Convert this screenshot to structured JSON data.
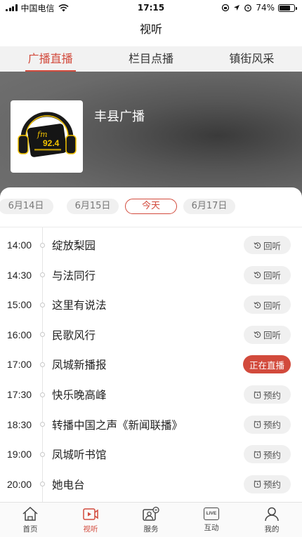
{
  "status_bar": {
    "carrier": "中国电信",
    "time": "17:15",
    "battery": "74%",
    "battery_level": 0.74
  },
  "header": {
    "title": "视听"
  },
  "tabs": [
    {
      "label": "广播直播",
      "active": true
    },
    {
      "label": "栏目点播",
      "active": false
    },
    {
      "label": "镇街风采",
      "active": false
    }
  ],
  "station": {
    "name": "丰县广播",
    "logo_text": {
      "fm": "fm",
      "freq": "92.4"
    }
  },
  "dates": [
    {
      "label": "6月14日",
      "selected": false
    },
    {
      "label": "6月15日",
      "selected": false
    },
    {
      "label": "今天",
      "selected": true
    },
    {
      "label": "6月17日",
      "selected": false
    }
  ],
  "programs": [
    {
      "time": "14:00",
      "title": "绽放梨园",
      "action": "回听",
      "icon": "replay-icon",
      "state": "replay"
    },
    {
      "time": "14:30",
      "title": "与法同行",
      "action": "回听",
      "icon": "replay-icon",
      "state": "replay"
    },
    {
      "time": "15:00",
      "title": "这里有说法",
      "action": "回听",
      "icon": "replay-icon",
      "state": "replay"
    },
    {
      "time": "16:00",
      "title": "民歌风行",
      "action": "回听",
      "icon": "replay-icon",
      "state": "replay"
    },
    {
      "time": "17:00",
      "title": "凤城新播报",
      "action": "正在直播",
      "icon": "",
      "state": "live"
    },
    {
      "time": "17:30",
      "title": "快乐晚高峰",
      "action": "预约",
      "icon": "alarm-clock-icon",
      "state": "reserve"
    },
    {
      "time": "18:30",
      "title": "转播中国之声《新闻联播》",
      "action": "预约",
      "icon": "alarm-clock-icon",
      "state": "reserve"
    },
    {
      "time": "19:00",
      "title": "凤城听书馆",
      "action": "预约",
      "icon": "alarm-clock-icon",
      "state": "reserve"
    },
    {
      "time": "20:00",
      "title": "她电台",
      "action": "预约",
      "icon": "alarm-clock-icon",
      "state": "reserve"
    }
  ],
  "bottom_nav": [
    {
      "label": "首页",
      "icon": "home-icon",
      "active": false
    },
    {
      "label": "视听",
      "icon": "video-play-icon",
      "active": true
    },
    {
      "label": "服务",
      "icon": "service-icon",
      "active": false
    },
    {
      "label": "互动",
      "icon": "live-icon",
      "active": false,
      "badge_text": "LIVE"
    },
    {
      "label": "我的",
      "icon": "person-icon",
      "active": false
    }
  ],
  "colors": {
    "accent": "#d24a3c",
    "tab_bar_bg": "#f2f2f2",
    "pill_bg": "#f0f0f0"
  }
}
